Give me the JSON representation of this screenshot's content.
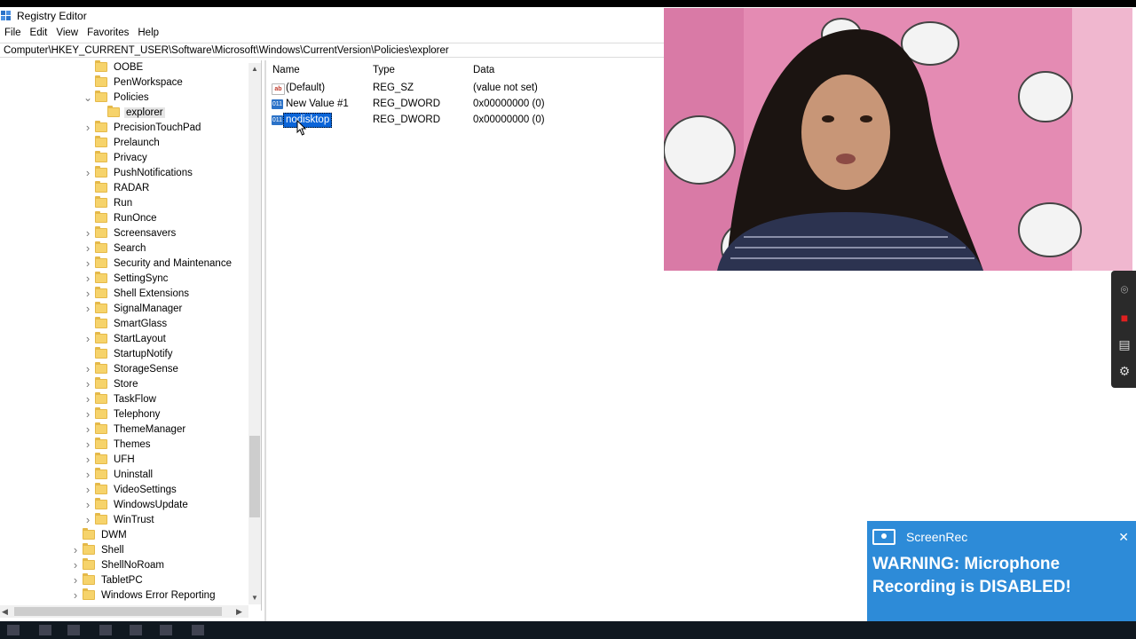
{
  "window": {
    "title": "Registry Editor",
    "menu": [
      "File",
      "Edit",
      "View",
      "Favorites",
      "Help"
    ],
    "address": "Computer\\HKEY_CURRENT_USER\\Software\\Microsoft\\Windows\\CurrentVersion\\Policies\\explorer"
  },
  "tree": {
    "items": [
      {
        "label": "OOBE",
        "expandable": false
      },
      {
        "label": "PenWorkspace",
        "expandable": false
      },
      {
        "label": "Policies",
        "expandable": true,
        "expanded": true
      },
      {
        "label": "explorer",
        "expandable": false,
        "selected": true
      },
      {
        "label": "PrecisionTouchPad",
        "expandable": true
      },
      {
        "label": "Prelaunch",
        "expandable": false
      },
      {
        "label": "Privacy",
        "expandable": false
      },
      {
        "label": "PushNotifications",
        "expandable": true
      },
      {
        "label": "RADAR",
        "expandable": false
      },
      {
        "label": "Run",
        "expandable": false
      },
      {
        "label": "RunOnce",
        "expandable": false
      },
      {
        "label": "Screensavers",
        "expandable": true
      },
      {
        "label": "Search",
        "expandable": true
      },
      {
        "label": "Security and Maintenance",
        "expandable": true
      },
      {
        "label": "SettingSync",
        "expandable": true
      },
      {
        "label": "Shell Extensions",
        "expandable": true
      },
      {
        "label": "SignalManager",
        "expandable": true
      },
      {
        "label": "SmartGlass",
        "expandable": false
      },
      {
        "label": "StartLayout",
        "expandable": true
      },
      {
        "label": "StartupNotify",
        "expandable": false
      },
      {
        "label": "StorageSense",
        "expandable": true
      },
      {
        "label": "Store",
        "expandable": true
      },
      {
        "label": "TaskFlow",
        "expandable": true
      },
      {
        "label": "Telephony",
        "expandable": true
      },
      {
        "label": "ThemeManager",
        "expandable": true
      },
      {
        "label": "Themes",
        "expandable": true
      },
      {
        "label": "UFH",
        "expandable": true
      },
      {
        "label": "Uninstall",
        "expandable": true
      },
      {
        "label": "VideoSettings",
        "expandable": true
      },
      {
        "label": "WindowsUpdate",
        "expandable": true
      },
      {
        "label": "WinTrust",
        "expandable": true
      },
      {
        "label": "DWM",
        "expandable": false
      },
      {
        "label": "Shell",
        "expandable": true
      },
      {
        "label": "ShellNoRoam",
        "expandable": true
      },
      {
        "label": "TabletPC",
        "expandable": true
      },
      {
        "label": "Windows Error Reporting",
        "expandable": true
      }
    ]
  },
  "list": {
    "headers": {
      "name": "Name",
      "type": "Type",
      "data": "Data"
    },
    "rows": [
      {
        "icon": "string-value-icon",
        "icon_text": "ab",
        "name": "(Default)",
        "type": "REG_SZ",
        "data": "(value not set)"
      },
      {
        "icon": "dword-value-icon",
        "icon_text": "011",
        "name": "New Value #1",
        "type": "REG_DWORD",
        "data": "0x00000000 (0)"
      },
      {
        "icon": "dword-value-icon",
        "icon_text": "011",
        "name": "nodisktop",
        "type": "REG_DWORD",
        "data": "0x00000000 (0)",
        "editing": true
      }
    ]
  },
  "toast": {
    "app": "ScreenRec",
    "message": "WARNING: Microphone Recording is DISABLED!",
    "color": "#2d8bd8"
  },
  "colors": {
    "selection": "#0a64d8",
    "folder": "#f6d36b"
  }
}
